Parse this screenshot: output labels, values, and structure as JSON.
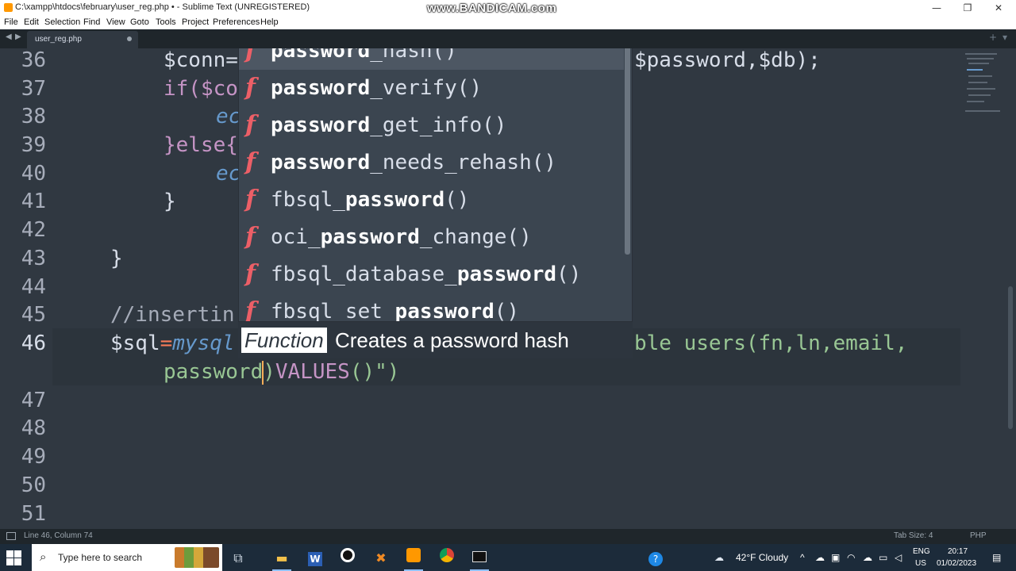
{
  "window": {
    "title": "C:\\xampp\\htdocs\\february\\user_reg.php • - Sublime Text (UNREGISTERED)",
    "watermark": "www.BANDICAM.com",
    "minimize": "—",
    "restore": "❐",
    "close": "✕"
  },
  "menu": [
    "File",
    "Edit",
    "Selection",
    "Find",
    "View",
    "Goto",
    "Tools",
    "Project",
    "Preferences",
    "Help"
  ],
  "tabs": {
    "active": "user_reg.php",
    "new_tab": "+",
    "tab_list": "▾"
  },
  "editor": {
    "line_numbers": [
      "36",
      "37",
      "38",
      "39",
      "40",
      "41",
      "42",
      "43",
      "44",
      "45",
      "46",
      "",
      "47",
      "48",
      "49",
      "50",
      "51"
    ],
    "lines": {
      "l36a": "$conn=",
      "l36b": "$password,$db);",
      "l37": "if($co",
      "l38": "ec",
      "l39": "}else{",
      "l40": "ec",
      "l41": "}",
      "l43": "}",
      "l45": "//insertin",
      "l46a_var": "$sql",
      "l46a_op": "=",
      "l46a_fn": "mysql",
      "l46b": "ble users(fn,ln,email,",
      "l46c_text": "password",
      "l46c_paren": ")",
      "l46c_values": "VALUES",
      "l46c_end": "()\")"
    }
  },
  "autocomplete": {
    "items": [
      {
        "kind": "f",
        "pre": "",
        "bold": "password",
        "post": "_hash()"
      },
      {
        "kind": "f",
        "pre": "",
        "bold": "password",
        "post": "_verify()"
      },
      {
        "kind": "f",
        "pre": "",
        "bold": "password",
        "post": "_get_info()"
      },
      {
        "kind": "f",
        "pre": "",
        "bold": "password",
        "post": "_needs_rehash()"
      },
      {
        "kind": "f",
        "pre": "fbsql_",
        "bold": "password",
        "post": "()"
      },
      {
        "kind": "f",
        "pre": "oci_",
        "bold": "password",
        "post": "_change()"
      },
      {
        "kind": "f",
        "pre": "fbsql_database_",
        "bold": "password",
        "post": "()"
      },
      {
        "kind": "f",
        "pre": "fbsql_set_",
        "bold": "password",
        "post": "()"
      }
    ],
    "doc_kind": "Function",
    "doc_text": "Creates a password hash"
  },
  "statusbar": {
    "position": "Line 46, Column 74",
    "tab_size": "Tab Size: 4",
    "syntax": "PHP"
  },
  "taskbar": {
    "search_placeholder": "Type here to search",
    "search_icon": "search-icon",
    "weather": "42°F  Cloudy",
    "lang_top": "ENG",
    "lang_bottom": "US",
    "time": "20:17",
    "date": "01/02/2023"
  },
  "colors": {
    "editor_bg": "#303841",
    "accent_function": "#ec5f67",
    "keyword": "#c594c5",
    "function": "#6699cc"
  }
}
